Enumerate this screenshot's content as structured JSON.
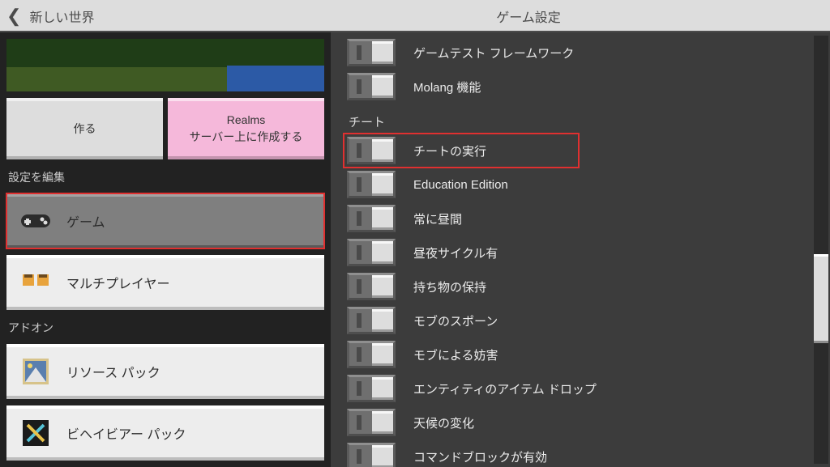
{
  "header": {
    "back_label": "新しい世界",
    "title": "ゲーム設定"
  },
  "left": {
    "create_button": "作る",
    "realms_button_line1": "Realms",
    "realms_button_line2": "サーバー上に作成する",
    "section_settings": "設定を編集",
    "nav": {
      "game": "ゲーム",
      "multiplayer": "マルチプレイヤー"
    },
    "section_addons": "アドオン",
    "addon": {
      "resource": "リソース パック",
      "behavior": "ビヘイビアー パック"
    }
  },
  "right": {
    "toggles_top": [
      {
        "label": "ゲームテスト フレームワーク",
        "on": false
      },
      {
        "label": "Molang 機能",
        "on": false
      }
    ],
    "group_cheats": "チート",
    "toggles_cheats": [
      {
        "label": "チートの実行",
        "on": false,
        "boxed": true
      },
      {
        "label": "Education Edition",
        "on": false
      },
      {
        "label": "常に昼間",
        "on": false
      },
      {
        "label": "昼夜サイクル有",
        "on": false
      },
      {
        "label": "持ち物の保持",
        "on": false
      },
      {
        "label": "モブのスポーン",
        "on": false
      },
      {
        "label": "モブによる妨害",
        "on": false
      },
      {
        "label": "エンティティのアイテム ドロップ",
        "on": false
      },
      {
        "label": "天候の変化",
        "on": false
      },
      {
        "label": "コマンドブロックが有効",
        "on": false
      }
    ]
  }
}
